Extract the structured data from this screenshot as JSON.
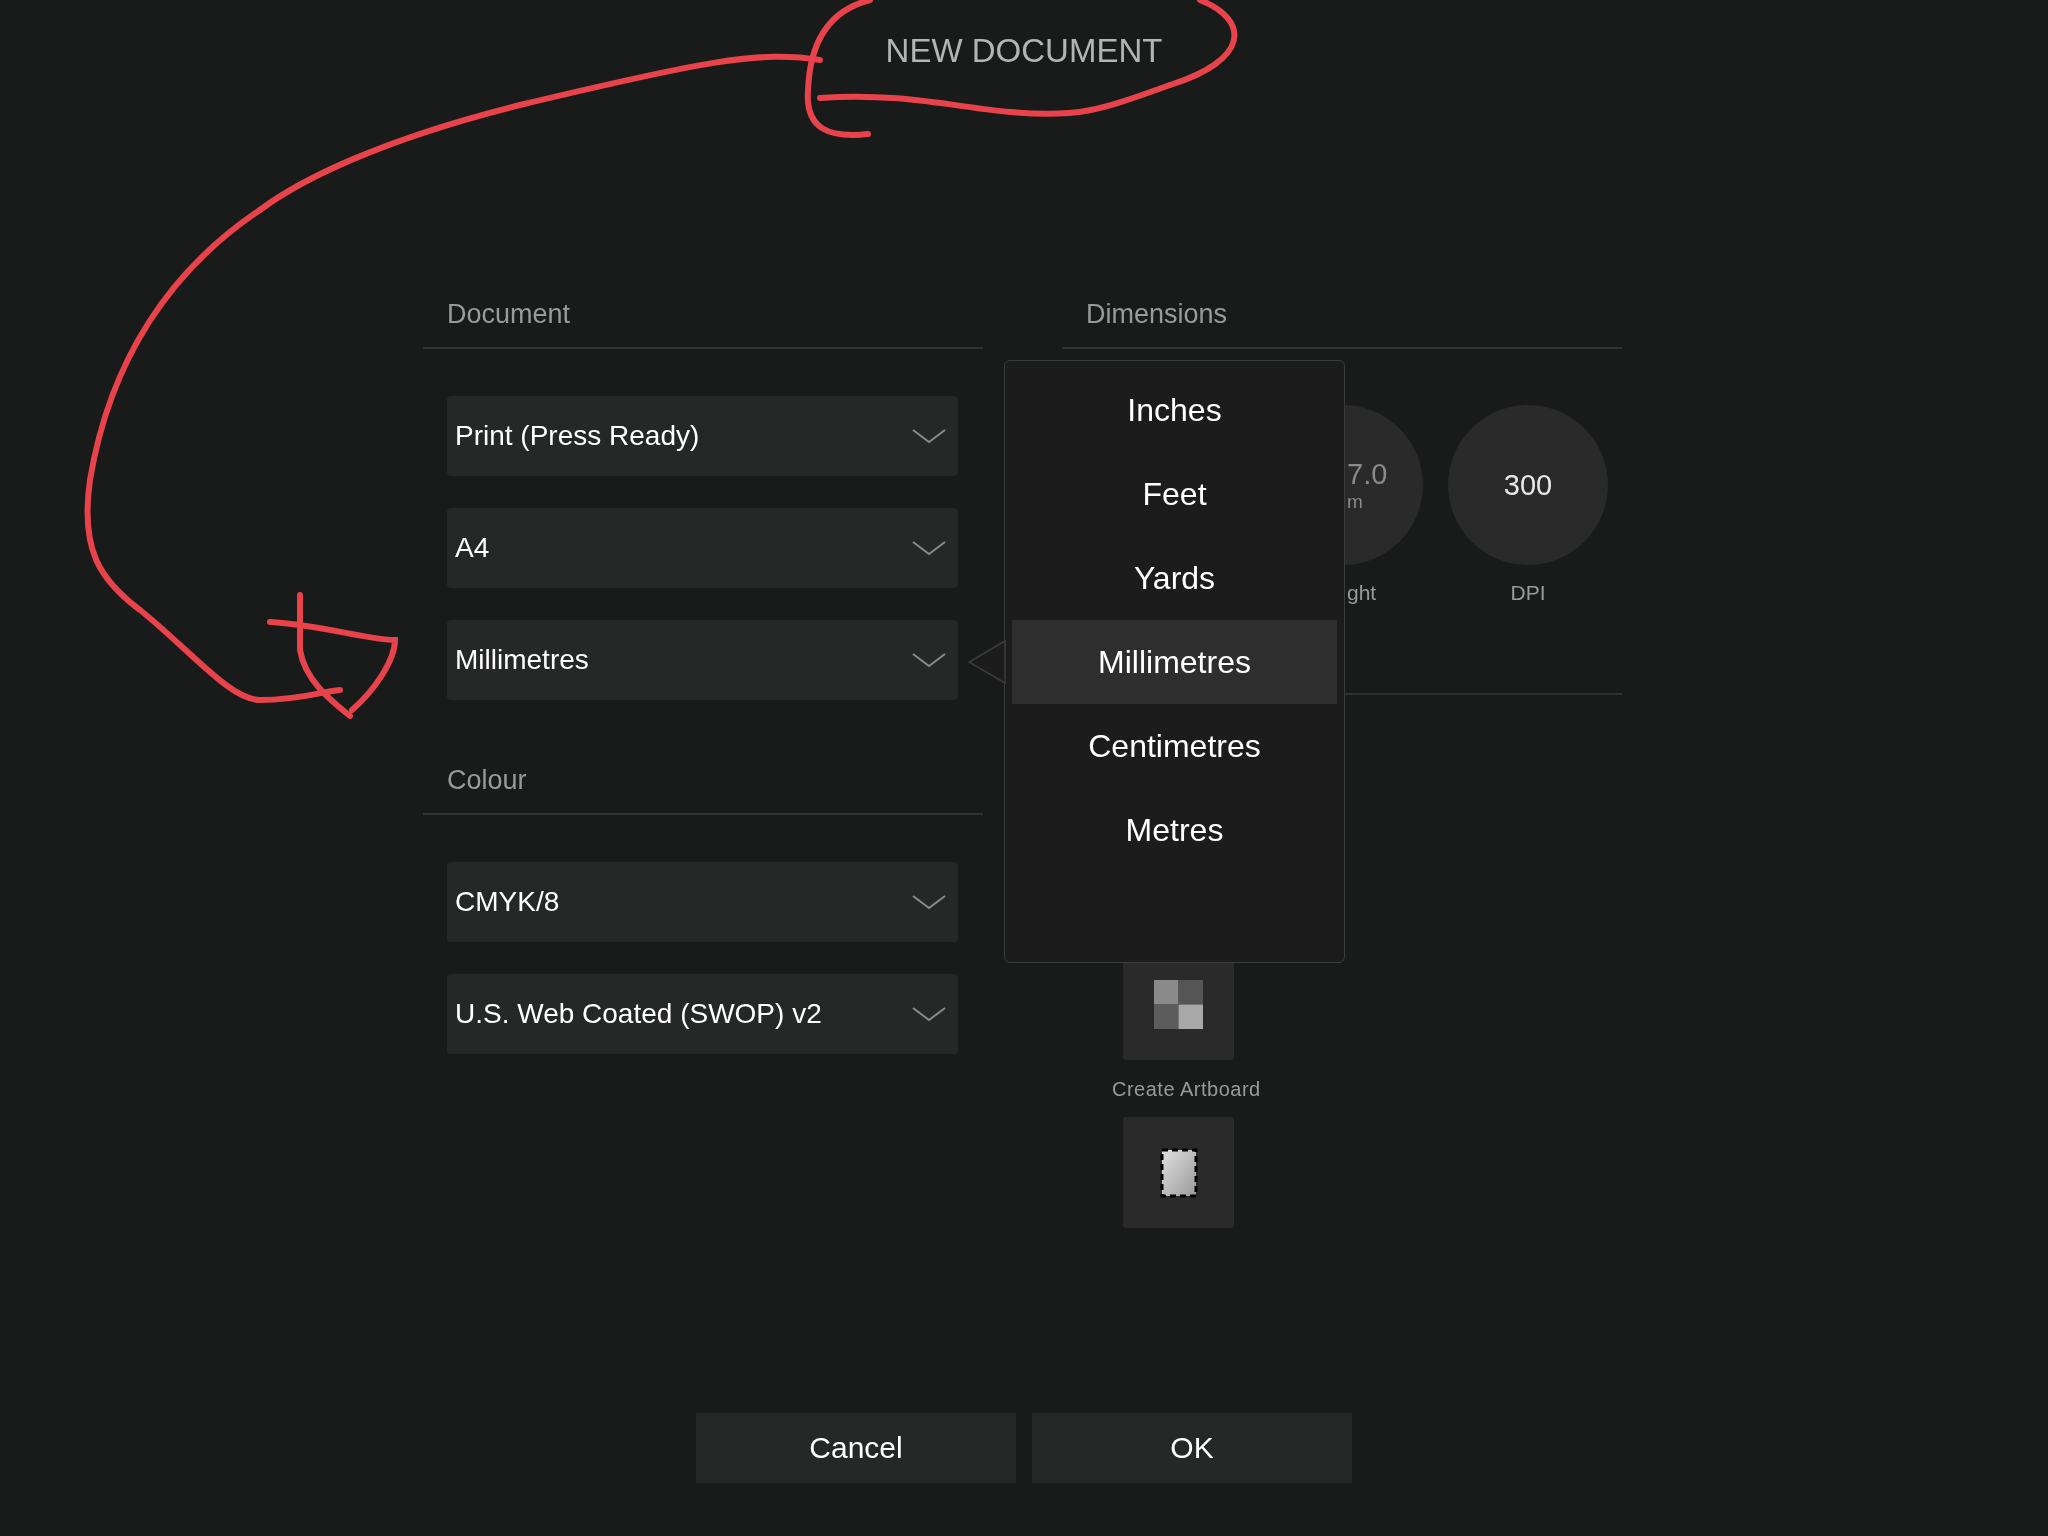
{
  "title": "NEW DOCUMENT",
  "document": {
    "header": "Document",
    "dropdowns": [
      "Print (Press Ready)",
      "A4",
      "Millimetres"
    ]
  },
  "colour": {
    "header": "Colour",
    "dropdowns": [
      "CMYK/8",
      "U.S. Web Coated (SWOP) v2"
    ]
  },
  "dimensions": {
    "header": "Dimensions",
    "fields": [
      {
        "kind": "clipped",
        "value": "7.0",
        "unit": "m",
        "label": "ght"
      },
      {
        "kind": "full",
        "value": "300",
        "label": "DPI"
      }
    ],
    "artboard_label": "Create Artboard"
  },
  "unit_menu": {
    "items": [
      {
        "label": "Inches",
        "selected": false
      },
      {
        "label": "Feet",
        "selected": false
      },
      {
        "label": "Yards",
        "selected": false
      },
      {
        "label": "Millimetres",
        "selected": true
      },
      {
        "label": "Centimetres",
        "selected": false
      },
      {
        "label": "Metres",
        "selected": false
      }
    ]
  },
  "buttons": [
    "Cancel",
    "OK"
  ]
}
